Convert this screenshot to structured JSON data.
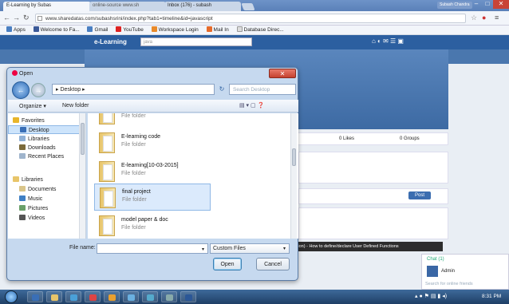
{
  "browser": {
    "tabs": [
      "E-Learning by Subas",
      "online-source www.sh",
      "Inbox (176) - subash"
    ],
    "user_badge": "Subash Chandra",
    "url": "www.sharedatas.com/subashsrini/index.php?tab1=timeline&id=javascript",
    "bookmarks": [
      "Apps",
      "Welcome to Fa...",
      "Gmail",
      "YouTube",
      "Workspace Login",
      "Mail In",
      "Database Direc..."
    ]
  },
  "site": {
    "logo": "e-Learning",
    "search_placeholder": "java",
    "stats": {
      "followers": "owers",
      "likes": "0 Likes",
      "groups": "0 Groups"
    },
    "post_button": "Post",
    "notice": "ression) - How to define/declare User Defined Functions",
    "chat": {
      "title": "Chat (1)",
      "user": "Admin",
      "search": "Search for online friends"
    }
  },
  "dialog": {
    "title": "Open",
    "breadcrumb": "Desktop",
    "search_placeholder": "Search Desktop",
    "organize": "Organize",
    "new_folder": "New folder",
    "nav": [
      {
        "label": "Favorites",
        "icon": "star-icon",
        "color": "#e8b52a"
      },
      {
        "label": "Desktop",
        "icon": "desktop-icon",
        "color": "#3a6fb6",
        "selected": true
      },
      {
        "label": "Libraries",
        "icon": "library-icon",
        "color": "#8fb0d6"
      },
      {
        "label": "Downloads",
        "icon": "downloads-icon",
        "color": "#7b6a3a"
      },
      {
        "label": "Recent Places",
        "icon": "recent-places-icon",
        "color": "#9fb4cc"
      },
      {
        "label": "Libraries",
        "icon": "library-icon",
        "color": "#e8c56a"
      },
      {
        "label": "Documents",
        "icon": "documents-icon",
        "color": "#d9c58a"
      },
      {
        "label": "Music",
        "icon": "music-icon",
        "color": "#3f7fc4"
      },
      {
        "label": "Pictures",
        "icon": "pictures-icon",
        "color": "#6aa06a"
      },
      {
        "label": "Videos",
        "icon": "videos-icon",
        "color": "#555"
      }
    ],
    "files": [
      {
        "name": "",
        "type": "File folder"
      },
      {
        "name": "E-learning code",
        "type": "File folder"
      },
      {
        "name": "E-learning[10-03-2015]",
        "type": "File folder"
      },
      {
        "name": "final project",
        "type": "File folder",
        "selected": true
      },
      {
        "name": "model paper & doc",
        "type": "File folder"
      }
    ],
    "file_name_label": "File name:",
    "file_name_value": "",
    "file_type": "Custom Files",
    "open_button": "Open",
    "cancel_button": "Cancel"
  },
  "taskbar": {
    "clock": "8:31 PM"
  }
}
